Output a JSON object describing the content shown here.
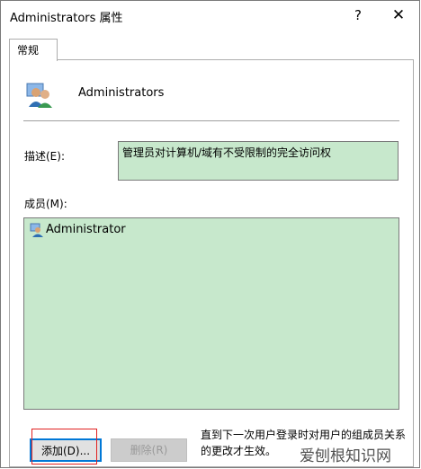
{
  "window": {
    "title": "Administrators 属性",
    "help_glyph": "?",
    "close_glyph": "✕"
  },
  "tabs": [
    {
      "label": "常规"
    }
  ],
  "group": {
    "name": "Administrators",
    "icon": "user-group-icon"
  },
  "description": {
    "label": "描述(E):",
    "value": "管理员对计算机/域有不受限制的完全访问权"
  },
  "members": {
    "label": "成员(M):",
    "items": [
      {
        "name": "Administrator",
        "icon": "user-icon"
      }
    ]
  },
  "buttons": {
    "add": "添加(D)...",
    "remove": "删除(R)"
  },
  "note": "直到下一次用户登录时对用户的组成员关系的更改才生效。",
  "watermark": "爱刨根知识网",
  "colors": {
    "field_bg": "#c7e8cc",
    "highlight_red": "#e02020",
    "focus_blue": "#0078d7"
  }
}
